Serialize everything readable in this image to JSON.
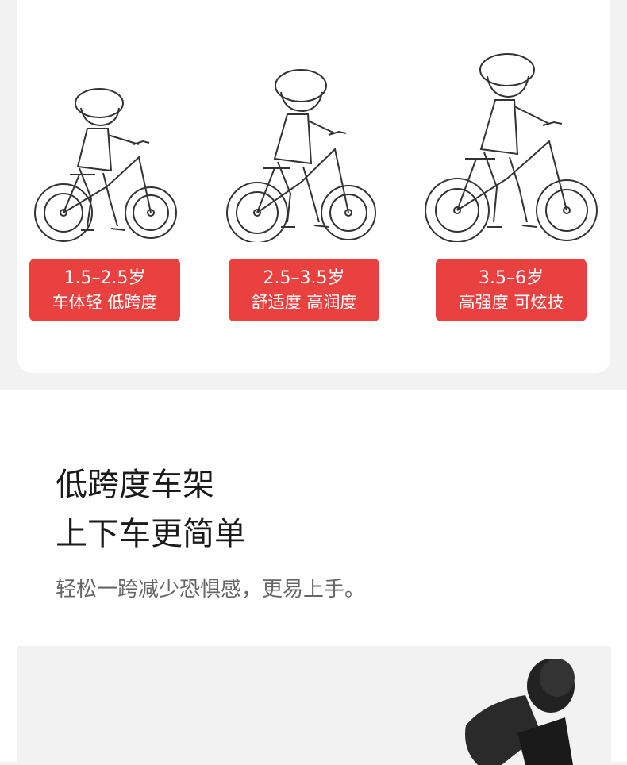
{
  "stages": [
    {
      "age": "1.5–2.5岁",
      "desc": "车体轻 低跨度"
    },
    {
      "age": "2.5–3.5岁",
      "desc": "舒适度 高润度"
    },
    {
      "age": "3.5–6岁",
      "desc": "高强度 可炫技"
    }
  ],
  "feature": {
    "title_line1": "低跨度车架",
    "title_line2": "上下车更简单",
    "subtitle": "轻松一跨减少恐惧感，更易上手。"
  },
  "colors": {
    "badge": "#e8413f",
    "page_bg": "#f2f2f2",
    "card_bg": "#ffffff"
  }
}
